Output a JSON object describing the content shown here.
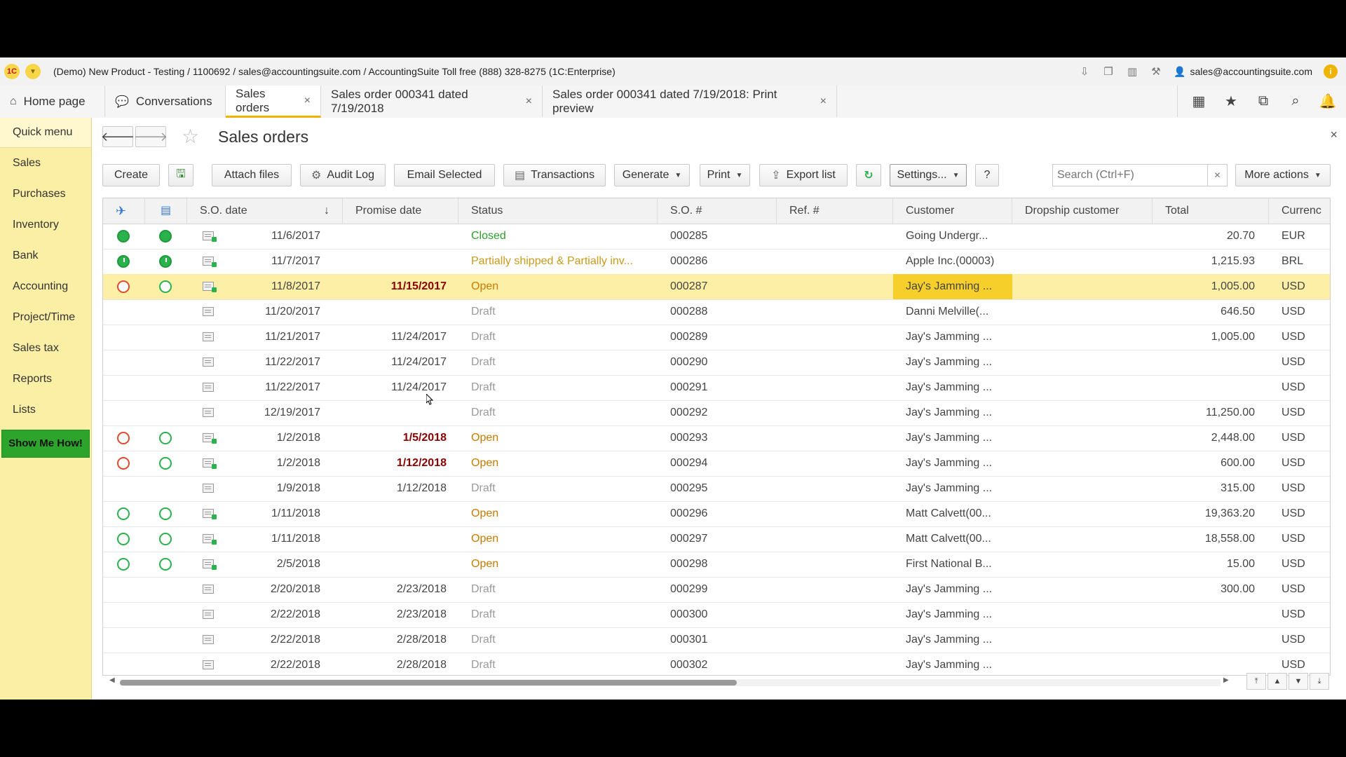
{
  "window": {
    "title": "(Demo) New Product - Testing / 1100692 / sales@accountingsuite.com / AccountingSuite Toll free (888) 328-8275  (1C:Enterprise)",
    "logo": "1C",
    "user": "sales@accountingsuite.com"
  },
  "tabs": [
    {
      "label": "Home page",
      "icon": "home-icon"
    },
    {
      "label": "Conversations",
      "icon": "chat-icon"
    },
    {
      "label": "Sales orders",
      "active": true
    },
    {
      "label": "Sales order 000341 dated 7/19/2018"
    },
    {
      "label": "Sales order 000341 dated 7/19/2018: Print preview"
    }
  ],
  "sidebar": {
    "items": [
      "Quick menu",
      "Sales",
      "Purchases",
      "Inventory",
      "Bank",
      "Accounting",
      "Project/Time",
      "Sales tax",
      "Reports",
      "Lists"
    ],
    "help_button": "Show Me How!"
  },
  "page": {
    "title": "Sales orders"
  },
  "toolbar": {
    "create": "Create",
    "attach_files": "Attach files",
    "audit_log": "Audit Log",
    "email_selected": "Email Selected",
    "transactions": "Transactions",
    "generate": "Generate",
    "print": "Print",
    "export_list": "Export list",
    "settings": "Settings...",
    "help": "?",
    "search_placeholder": "Search (Ctrl+F)",
    "more_actions": "More actions"
  },
  "columns": [
    "S.O. date",
    "Promise date",
    "Status",
    "S.O. #",
    "Ref. #",
    "Customer",
    "Dropship customer",
    "Total",
    "Currenc"
  ],
  "rows": [
    {
      "s1": "green-full",
      "s2": "green-full",
      "doc": "posted",
      "date": "11/6/2017",
      "promise": "",
      "promise_red": false,
      "status": "Closed",
      "status_cls": "closed",
      "so": "000285",
      "ref": "",
      "customer": "Going Undergr...",
      "dropship": "",
      "total": "20.70",
      "currency": "EUR"
    },
    {
      "s1": "clock",
      "s2": "clock",
      "doc": "posted",
      "date": "11/7/2017",
      "promise": "",
      "promise_red": false,
      "status": "Partially shipped & Partially inv...",
      "status_cls": "partial",
      "so": "000286",
      "ref": "",
      "customer": "Apple Inc.(00003)",
      "dropship": "",
      "total": "1,215.93",
      "currency": "BRL"
    },
    {
      "s1": "red-ring",
      "s2": "green-ring",
      "doc": "posted",
      "date": "11/8/2017",
      "promise": "11/15/2017",
      "promise_red": true,
      "status": "Open",
      "status_cls": "open",
      "so": "000287",
      "ref": "",
      "customer": "Jay's Jamming ...",
      "dropship": "",
      "total": "1,005.00",
      "currency": "USD",
      "selected": true
    },
    {
      "s1": "",
      "s2": "",
      "doc": "draft",
      "date": "11/20/2017",
      "promise": "",
      "promise_red": false,
      "status": "Draft",
      "status_cls": "draft",
      "so": "000288",
      "ref": "",
      "customer": "Danni Melville(...",
      "dropship": "",
      "total": "646.50",
      "currency": "USD"
    },
    {
      "s1": "",
      "s2": "",
      "doc": "draft",
      "date": "11/21/2017",
      "promise": "11/24/2017",
      "promise_red": false,
      "status": "Draft",
      "status_cls": "draft",
      "so": "000289",
      "ref": "",
      "customer": "Jay's Jamming ...",
      "dropship": "",
      "total": "1,005.00",
      "currency": "USD"
    },
    {
      "s1": "",
      "s2": "",
      "doc": "draft",
      "date": "11/22/2017",
      "promise": "11/24/2017",
      "promise_red": false,
      "status": "Draft",
      "status_cls": "draft",
      "so": "000290",
      "ref": "",
      "customer": "Jay's Jamming ...",
      "dropship": "",
      "total": "",
      "currency": "USD"
    },
    {
      "s1": "",
      "s2": "",
      "doc": "draft",
      "date": "11/22/2017",
      "promise": "11/24/2017",
      "promise_red": false,
      "status": "Draft",
      "status_cls": "draft",
      "so": "000291",
      "ref": "",
      "customer": "Jay's Jamming ...",
      "dropship": "",
      "total": "",
      "currency": "USD"
    },
    {
      "s1": "",
      "s2": "",
      "doc": "draft",
      "date": "12/19/2017",
      "promise": "",
      "promise_red": false,
      "status": "Draft",
      "status_cls": "draft",
      "so": "000292",
      "ref": "",
      "customer": "Jay's Jamming ...",
      "dropship": "",
      "total": "11,250.00",
      "currency": "USD"
    },
    {
      "s1": "red-ring",
      "s2": "green-ring",
      "doc": "posted",
      "date": "1/2/2018",
      "promise": "1/5/2018",
      "promise_red": true,
      "status": "Open",
      "status_cls": "open",
      "so": "000293",
      "ref": "",
      "customer": "Jay's Jamming ...",
      "dropship": "",
      "total": "2,448.00",
      "currency": "USD"
    },
    {
      "s1": "red-ring",
      "s2": "green-ring",
      "doc": "posted",
      "date": "1/2/2018",
      "promise": "1/12/2018",
      "promise_red": true,
      "status": "Open",
      "status_cls": "open",
      "so": "000294",
      "ref": "",
      "customer": "Jay's Jamming ...",
      "dropship": "",
      "total": "600.00",
      "currency": "USD"
    },
    {
      "s1": "",
      "s2": "",
      "doc": "draft",
      "date": "1/9/2018",
      "promise": "1/12/2018",
      "promise_red": false,
      "status": "Draft",
      "status_cls": "draft",
      "so": "000295",
      "ref": "",
      "customer": "Jay's Jamming ...",
      "dropship": "",
      "total": "315.00",
      "currency": "USD"
    },
    {
      "s1": "green-ring",
      "s2": "green-ring",
      "doc": "posted",
      "date": "1/11/2018",
      "promise": "",
      "promise_red": false,
      "status": "Open",
      "status_cls": "open",
      "so": "000296",
      "ref": "",
      "customer": "Matt Calvett(00...",
      "dropship": "",
      "total": "19,363.20",
      "currency": "USD"
    },
    {
      "s1": "green-ring",
      "s2": "green-ring",
      "doc": "posted",
      "date": "1/11/2018",
      "promise": "",
      "promise_red": false,
      "status": "Open",
      "status_cls": "open",
      "so": "000297",
      "ref": "",
      "customer": "Matt Calvett(00...",
      "dropship": "",
      "total": "18,558.00",
      "currency": "USD"
    },
    {
      "s1": "green-ring",
      "s2": "green-ring",
      "doc": "posted",
      "date": "2/5/2018",
      "promise": "",
      "promise_red": false,
      "status": "Open",
      "status_cls": "open",
      "so": "000298",
      "ref": "",
      "customer": "First National B...",
      "dropship": "",
      "total": "15.00",
      "currency": "USD"
    },
    {
      "s1": "",
      "s2": "",
      "doc": "draft",
      "date": "2/20/2018",
      "promise": "2/23/2018",
      "promise_red": false,
      "status": "Draft",
      "status_cls": "draft",
      "so": "000299",
      "ref": "",
      "customer": "Jay's Jamming ...",
      "dropship": "",
      "total": "300.00",
      "currency": "USD"
    },
    {
      "s1": "",
      "s2": "",
      "doc": "draft",
      "date": "2/22/2018",
      "promise": "2/23/2018",
      "promise_red": false,
      "status": "Draft",
      "status_cls": "draft",
      "so": "000300",
      "ref": "",
      "customer": "Jay's Jamming ...",
      "dropship": "",
      "total": "",
      "currency": "USD"
    },
    {
      "s1": "",
      "s2": "",
      "doc": "draft",
      "date": "2/22/2018",
      "promise": "2/28/2018",
      "promise_red": false,
      "status": "Draft",
      "status_cls": "draft",
      "so": "000301",
      "ref": "",
      "customer": "Jay's Jamming ...",
      "dropship": "",
      "total": "",
      "currency": "USD"
    },
    {
      "s1": "",
      "s2": "",
      "doc": "draft",
      "date": "2/22/2018",
      "promise": "2/28/2018",
      "promise_red": false,
      "status": "Draft",
      "status_cls": "draft",
      "so": "000302",
      "ref": "",
      "customer": "Jay's Jamming ...",
      "dropship": "",
      "total": "",
      "currency": "USD"
    }
  ],
  "colors": {
    "sidebar_bg": "#fbeea5",
    "selected_row": "#fdf0a6",
    "customer_highlight": "#f6cf2a",
    "status_closed": "#2c9c2c",
    "status_open": "#c87a00",
    "status_draft": "#9a9a9a",
    "promise_overdue": "#8b0000",
    "help_button": "#2da52d"
  }
}
